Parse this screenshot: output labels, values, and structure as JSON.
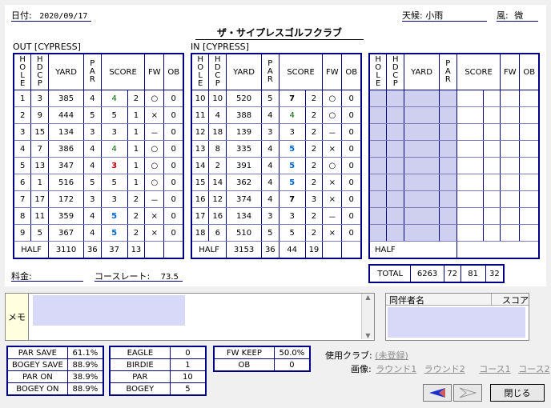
{
  "header": {
    "date_label": "日付:",
    "date": "2020/09/17",
    "title": "ザ・サイプレスゴルフクラブ",
    "weather_label": "天候:",
    "weather": "小雨",
    "wind_label": "風:",
    "wind": "微"
  },
  "out_label": "OUT [CYPRESS]",
  "in_label": "IN [CYPRESS]",
  "cols": {
    "hole": "HOLE",
    "hdcp": "HDCP",
    "yard": "YARD",
    "par": "PAR",
    "score": "SCORE",
    "fw": "FW",
    "ob": "OB"
  },
  "out_rows": [
    {
      "hole": "1",
      "hdcp": "3",
      "yard": "385",
      "par": "4",
      "score": "4",
      "putt": "2",
      "fw": "○",
      "ob": "0",
      "cls": "green"
    },
    {
      "hole": "2",
      "hdcp": "9",
      "yard": "444",
      "par": "5",
      "score": "5",
      "putt": "1",
      "fw": "×",
      "ob": "0",
      "cls": ""
    },
    {
      "hole": "3",
      "hdcp": "15",
      "yard": "134",
      "par": "3",
      "score": "3",
      "putt": "1",
      "fw": "－",
      "ob": "0",
      "cls": ""
    },
    {
      "hole": "4",
      "hdcp": "7",
      "yard": "386",
      "par": "4",
      "score": "4",
      "putt": "1",
      "fw": "○",
      "ob": "0",
      "cls": "green"
    },
    {
      "hole": "5",
      "hdcp": "13",
      "yard": "347",
      "par": "4",
      "score": "3",
      "putt": "1",
      "fw": "○",
      "ob": "0",
      "cls": "red"
    },
    {
      "hole": "6",
      "hdcp": "1",
      "yard": "516",
      "par": "5",
      "score": "5",
      "putt": "1",
      "fw": "○",
      "ob": "0",
      "cls": ""
    },
    {
      "hole": "7",
      "hdcp": "17",
      "yard": "172",
      "par": "3",
      "score": "3",
      "putt": "2",
      "fw": "－",
      "ob": "0",
      "cls": ""
    },
    {
      "hole": "8",
      "hdcp": "11",
      "yard": "359",
      "par": "4",
      "score": "5",
      "putt": "2",
      "fw": "×",
      "ob": "0",
      "cls": "blue"
    },
    {
      "hole": "9",
      "hdcp": "5",
      "yard": "367",
      "par": "4",
      "score": "5",
      "putt": "2",
      "fw": "×",
      "ob": "0",
      "cls": "blue"
    }
  ],
  "out_half": {
    "label": "HALF",
    "yard": "3110",
    "par": "36",
    "score": "37",
    "putt": "13"
  },
  "in_rows": [
    {
      "hole": "10",
      "hdcp": "10",
      "yard": "520",
      "par": "5",
      "score": "7",
      "putt": "2",
      "fw": "○",
      "ob": "0",
      "cls": "bold"
    },
    {
      "hole": "11",
      "hdcp": "4",
      "yard": "388",
      "par": "4",
      "score": "4",
      "putt": "2",
      "fw": "○",
      "ob": "0",
      "cls": "green"
    },
    {
      "hole": "12",
      "hdcp": "18",
      "yard": "139",
      "par": "3",
      "score": "3",
      "putt": "2",
      "fw": "－",
      "ob": "0",
      "cls": ""
    },
    {
      "hole": "13",
      "hdcp": "8",
      "yard": "335",
      "par": "4",
      "score": "5",
      "putt": "2",
      "fw": "×",
      "ob": "0",
      "cls": "blue"
    },
    {
      "hole": "14",
      "hdcp": "2",
      "yard": "391",
      "par": "4",
      "score": "5",
      "putt": "2",
      "fw": "○",
      "ob": "0",
      "cls": "blue"
    },
    {
      "hole": "15",
      "hdcp": "14",
      "yard": "362",
      "par": "4",
      "score": "5",
      "putt": "2",
      "fw": "×",
      "ob": "0",
      "cls": "blue"
    },
    {
      "hole": "16",
      "hdcp": "12",
      "yard": "374",
      "par": "4",
      "score": "7",
      "putt": "3",
      "fw": "×",
      "ob": "0",
      "cls": "bold"
    },
    {
      "hole": "17",
      "hdcp": "16",
      "yard": "134",
      "par": "3",
      "score": "3",
      "putt": "2",
      "fw": "－",
      "ob": "0",
      "cls": ""
    },
    {
      "hole": "18",
      "hdcp": "6",
      "yard": "510",
      "par": "5",
      "score": "5",
      "putt": "2",
      "fw": "×",
      "ob": "0",
      "cls": ""
    }
  ],
  "in_half": {
    "label": "HALF",
    "yard": "3153",
    "par": "36",
    "score": "44",
    "putt": "19"
  },
  "third": {
    "half_label": "HALF",
    "total_label": "TOTAL",
    "total_yard": "6263",
    "total_par": "72",
    "total_score": "81",
    "total_putt": "32"
  },
  "footer": {
    "fee_label": "料金:",
    "fee": "",
    "rating_label": "コースレート:",
    "rating": "73.5"
  },
  "memo": {
    "label": "メモ",
    "text": ""
  },
  "companions": {
    "col_name": "同伴者名",
    "col_score": "スコア"
  },
  "stats_left": [
    {
      "label": "PAR SAVE",
      "value": "61.1%"
    },
    {
      "label": "BOGEY SAVE",
      "value": "88.9%"
    },
    {
      "label": "PAR ON",
      "value": "38.9%"
    },
    {
      "label": "BOGEY ON",
      "value": "88.9%"
    }
  ],
  "stats_mid": [
    {
      "label": "EAGLE",
      "value": "0"
    },
    {
      "label": "BIRDIE",
      "value": "1"
    },
    {
      "label": "PAR",
      "value": "10"
    },
    {
      "label": "BOGEY",
      "value": "5"
    }
  ],
  "stats_right": [
    {
      "label": "FW KEEP",
      "value": "50.0%"
    },
    {
      "label": "OB",
      "value": "0"
    }
  ],
  "club": {
    "label": "使用クラブ:",
    "value": "(未登録)"
  },
  "images": {
    "label": "画像:",
    "round1": "ラウンド1",
    "round2": "ラウンド2",
    "course1": "コース1",
    "course2": "コース2"
  },
  "buttons": {
    "close": "閉じる"
  }
}
